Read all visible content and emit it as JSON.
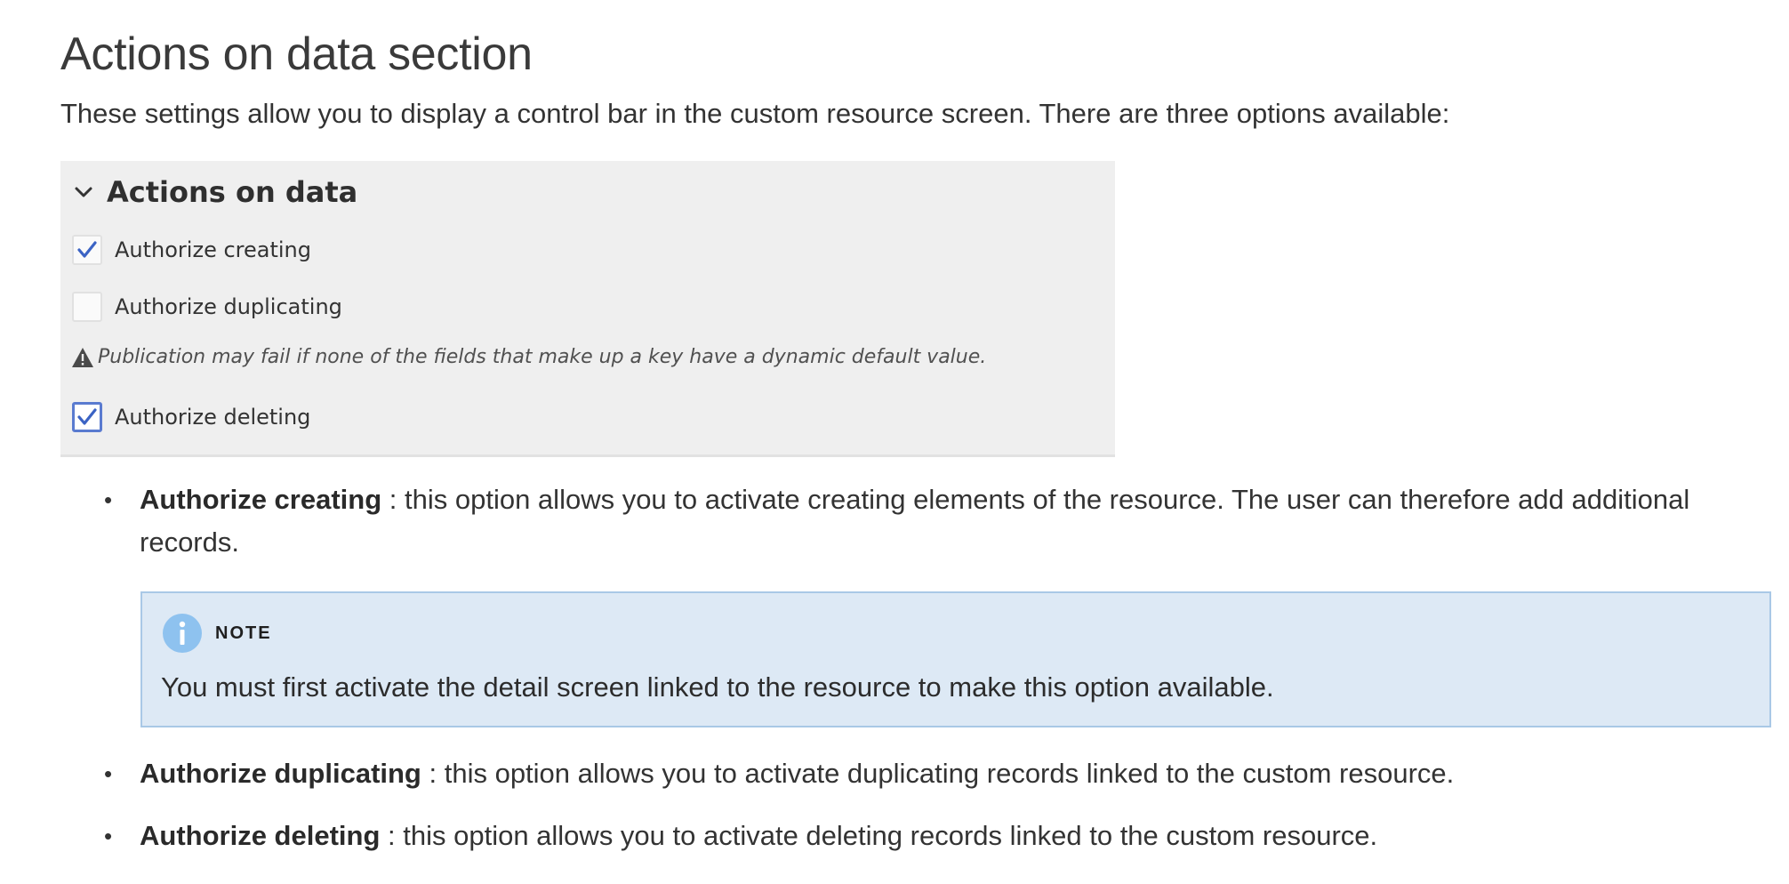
{
  "page": {
    "title": "Actions on data section",
    "intro": "These settings allow you to display a control bar in the custom resource screen. There are three options available:"
  },
  "panel": {
    "heading": "Actions on data",
    "chevron_icon": "chevron-down-icon",
    "checkboxes": [
      {
        "label": "Authorize creating",
        "checked": true
      },
      {
        "label": "Authorize duplicating",
        "checked": false
      },
      {
        "label": "Authorize deleting",
        "checked": true
      }
    ],
    "warning_icon": "warning-icon",
    "warning": "Publication may fail if none of the fields that make up a key have a dynamic default value.",
    "check_color": "#3b63c4"
  },
  "options": [
    {
      "name": "Authorize creating",
      "description": ": this option allows you to activate creating elements of the resource. The user can therefore add additional records."
    },
    {
      "name": "Authorize duplicating",
      "description": ": this option allows you to activate duplicating records linked to the custom resource."
    },
    {
      "name": "Authorize deleting",
      "description": ": this option allows you to activate deleting records linked to the custom resource."
    }
  ],
  "note": {
    "icon": "info-icon",
    "title": "NOTE",
    "text": "You must first activate the detail screen linked to the resource to make this option available.",
    "background": "#dde9f5",
    "border": "#a9c8e6"
  }
}
